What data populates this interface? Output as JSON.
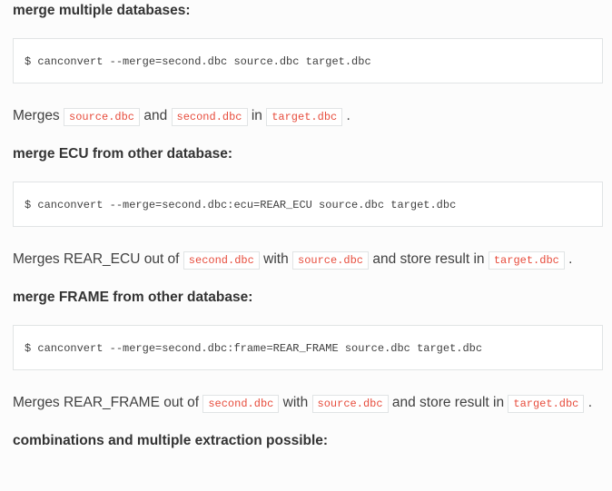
{
  "sections": [
    {
      "id": "s0",
      "heading": "merge multiple databases:",
      "code": "$ canconvert --merge=second.dbc source.dbc target.dbc",
      "desc_pre": "Merges ",
      "tok0": "source.dbc",
      "join0": " and ",
      "tok1": "second.dbc",
      "join1": " in ",
      "tok2": "target.dbc",
      "desc_post": " ."
    },
    {
      "id": "s1",
      "heading": "merge ECU from other database:",
      "code": "$ canconvert --merge=second.dbc:ecu=REAR_ECU source.dbc target.dbc",
      "desc_pre": "Merges REAR_ECU out of ",
      "tok0": "second.dbc",
      "join0": " with ",
      "tok1": "source.dbc",
      "join1": " and store result in ",
      "tok2": "target.dbc",
      "desc_post": " ."
    },
    {
      "id": "s2",
      "heading": "merge FRAME from other database:",
      "code": "$ canconvert --merge=second.dbc:frame=REAR_FRAME source.dbc target.dbc",
      "desc_pre": "Merges REAR_FRAME out of ",
      "tok0": "second.dbc",
      "join0": " with ",
      "tok1": "source.dbc",
      "join1": " and store result in ",
      "tok2": "target.dbc",
      "desc_post": " ."
    }
  ],
  "trailing_heading": "combinations and multiple extraction possible:"
}
